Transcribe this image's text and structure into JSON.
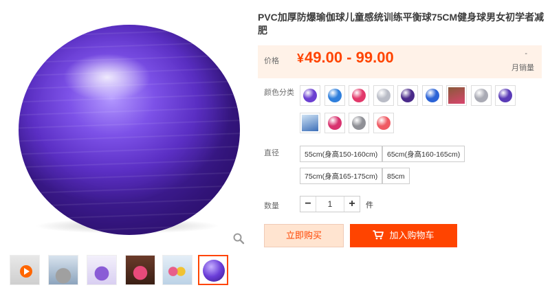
{
  "product": {
    "title": "PVC加厚防爆瑜伽球儿童感统训练平衡球75CM健身球男女初学者减肥",
    "price_label": "价格",
    "currency": "¥",
    "price_range": "49.00 - 99.00",
    "sales_count": "-",
    "sales_label": "月销量",
    "accent_color": "#ff4400"
  },
  "gallery": {
    "zoom_icon": "magnifier-icon",
    "thumbnails": [
      "video-thumbnail",
      "photo-thumbnail",
      "photo-thumbnail",
      "photo-thumbnail",
      "photo-thumbnail",
      "photo-thumbnail-selected"
    ]
  },
  "options": {
    "color_label": "颜色分类",
    "colors": [
      {
        "name": "purple",
        "hex": "#6b3fd1"
      },
      {
        "name": "blue",
        "hex": "#2f7fdc"
      },
      {
        "name": "pink-red",
        "hex": "#e2386a"
      },
      {
        "name": "silver",
        "hex": "#b9bcc6"
      },
      {
        "name": "dark-purple",
        "hex": "#4a2a8a"
      },
      {
        "name": "royal-blue",
        "hex": "#2b63d6"
      },
      {
        "name": "photo-pink",
        "hex": "#d9456e"
      },
      {
        "name": "grey",
        "hex": "#a9aab4"
      },
      {
        "name": "purple-pump",
        "hex": "#5a3bb7"
      },
      {
        "name": "photo-blue",
        "hex": "#3d6fb8"
      },
      {
        "name": "rose",
        "hex": "#d8336f"
      },
      {
        "name": "graphite",
        "hex": "#8f9096"
      },
      {
        "name": "light-red",
        "hex": "#ef5a63"
      }
    ],
    "size_label": "直径",
    "sizes": [
      "55cm(身高150-160cm)",
      "65cm(身高160-165cm)",
      "75cm(身高165-175cm)",
      "85cm"
    ],
    "quantity_label": "数量",
    "quantity_value": "1",
    "quantity_unit": "件",
    "minus_symbol": "−",
    "plus_symbol": "+"
  },
  "actions": {
    "buy_now": "立即购买",
    "add_to_cart": "加入购物车",
    "cart_icon": "shopping-cart-icon"
  }
}
